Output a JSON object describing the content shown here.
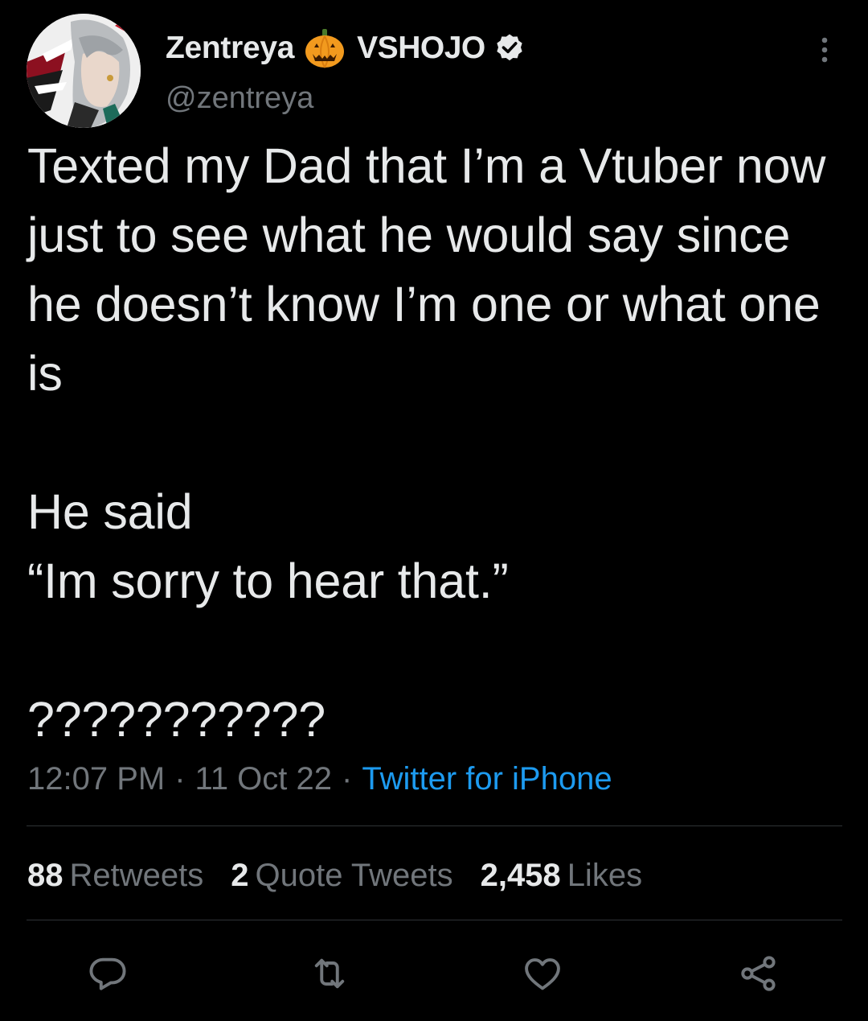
{
  "author": {
    "display_name": "Zentreya",
    "affiliation": "VSHOJO",
    "handle": "@zentreya",
    "badge_icon": "pumpkin-emoji-icon",
    "verified_icon": "verified-badge-icon"
  },
  "tweet": {
    "text": "Texted my Dad that I’m a Vtuber now just to see what he would say since he doesn’t know I’m one or what one is\n\nHe said\n“Im sorry to hear that.”\n\n???????????",
    "time": "12:07 PM",
    "date": "11 Oct 22",
    "separator": "·",
    "source": "Twitter for iPhone"
  },
  "stats": {
    "retweets_count": "88",
    "retweets_label": "Retweets",
    "quotes_count": "2",
    "quotes_label": "Quote Tweets",
    "likes_count": "2,458",
    "likes_label": "Likes"
  },
  "actions": {
    "reply_icon": "reply-icon",
    "retweet_icon": "retweet-icon",
    "like_icon": "heart-icon",
    "share_icon": "share-icon"
  },
  "colors": {
    "background": "#000000",
    "text": "#e7e9ea",
    "secondary": "#71767b",
    "link": "#1d9bf0",
    "divider": "#2f3336"
  }
}
